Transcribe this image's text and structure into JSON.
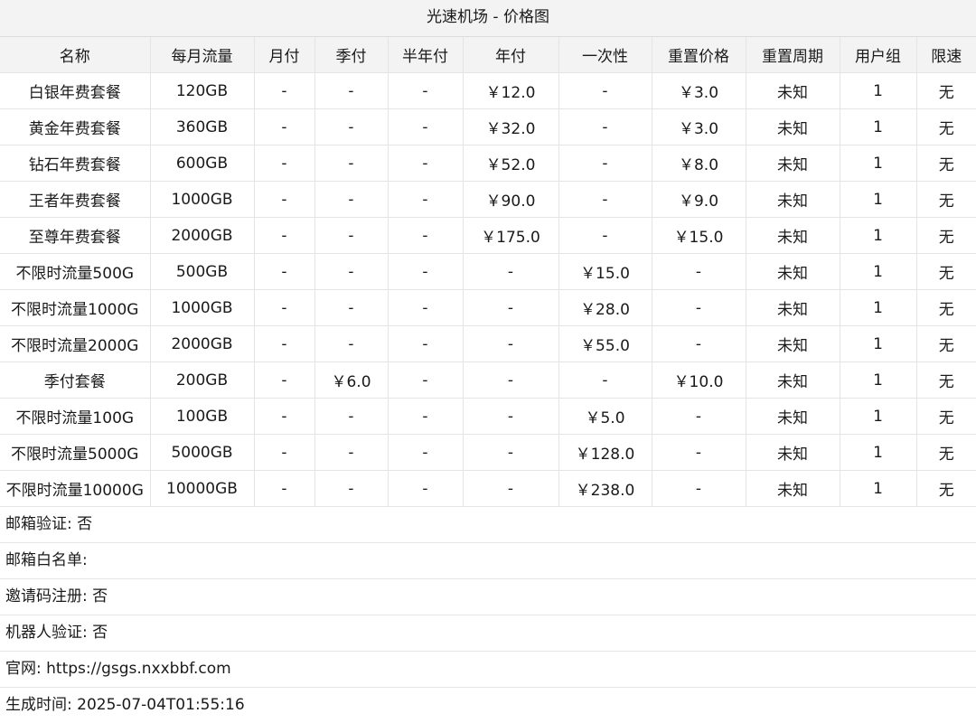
{
  "title": "光速机场 - 价格图",
  "columns": [
    "名称",
    "每月流量",
    "月付",
    "季付",
    "半年付",
    "年付",
    "一次性",
    "重置价格",
    "重置周期",
    "用户组",
    "限速"
  ],
  "rows": [
    [
      "白银年费套餐",
      "120GB",
      "-",
      "-",
      "-",
      "￥12.0",
      "-",
      "￥3.0",
      "未知",
      "1",
      "无"
    ],
    [
      "黄金年费套餐",
      "360GB",
      "-",
      "-",
      "-",
      "￥32.0",
      "-",
      "￥3.0",
      "未知",
      "1",
      "无"
    ],
    [
      "钻石年费套餐",
      "600GB",
      "-",
      "-",
      "-",
      "￥52.0",
      "-",
      "￥8.0",
      "未知",
      "1",
      "无"
    ],
    [
      "王者年费套餐",
      "1000GB",
      "-",
      "-",
      "-",
      "￥90.0",
      "-",
      "￥9.0",
      "未知",
      "1",
      "无"
    ],
    [
      "至尊年费套餐",
      "2000GB",
      "-",
      "-",
      "-",
      "￥175.0",
      "-",
      "￥15.0",
      "未知",
      "1",
      "无"
    ],
    [
      "不限时流量500G",
      "500GB",
      "-",
      "-",
      "-",
      "-",
      "￥15.0",
      "-",
      "未知",
      "1",
      "无"
    ],
    [
      "不限时流量1000G",
      "1000GB",
      "-",
      "-",
      "-",
      "-",
      "￥28.0",
      "-",
      "未知",
      "1",
      "无"
    ],
    [
      "不限时流量2000G",
      "2000GB",
      "-",
      "-",
      "-",
      "-",
      "￥55.0",
      "-",
      "未知",
      "1",
      "无"
    ],
    [
      "季付套餐",
      "200GB",
      "-",
      "￥6.0",
      "-",
      "-",
      "-",
      "￥10.0",
      "未知",
      "1",
      "无"
    ],
    [
      "不限时流量100G",
      "100GB",
      "-",
      "-",
      "-",
      "-",
      "￥5.0",
      "-",
      "未知",
      "1",
      "无"
    ],
    [
      "不限时流量5000G",
      "5000GB",
      "-",
      "-",
      "-",
      "-",
      "￥128.0",
      "-",
      "未知",
      "1",
      "无"
    ],
    [
      "不限时流量10000G",
      "10000GB",
      "-",
      "-",
      "-",
      "-",
      "￥238.0",
      "-",
      "未知",
      "1",
      "无"
    ]
  ],
  "info": [
    "邮箱验证: 否",
    "邮箱白名单: ",
    "邀请码注册: 否",
    "机器人验证: 否",
    "官网: https://gsgs.nxxbbf.com",
    "生成时间: 2025-07-04T01:55:16"
  ]
}
